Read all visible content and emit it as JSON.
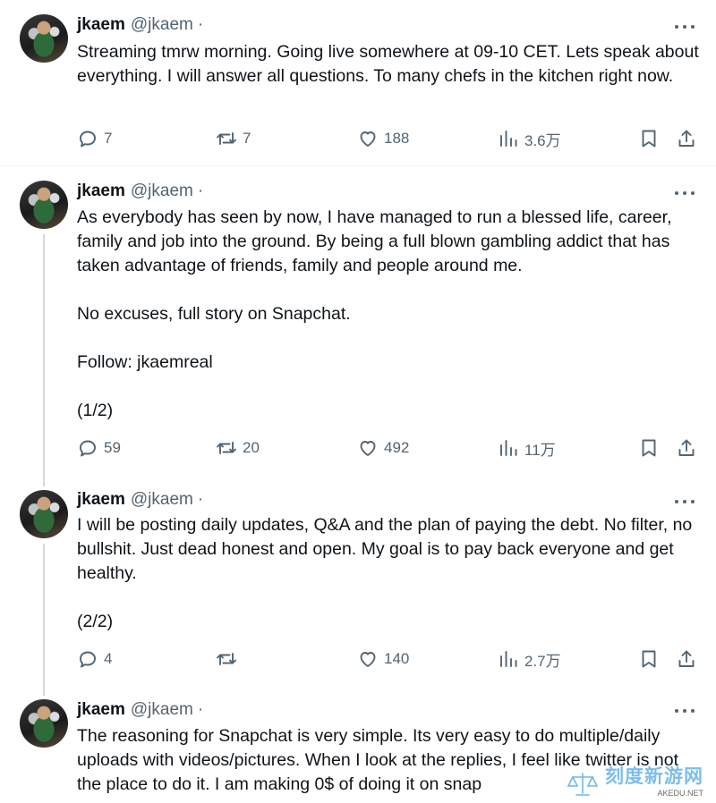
{
  "colors": {
    "text": "#0f1419",
    "secondary": "#536471",
    "divider": "#eff3f4",
    "thread_line": "#cfd9de"
  },
  "tweets": [
    {
      "name": "jkaem",
      "handle": "@jkaem",
      "separator": "·",
      "text": "Streaming tmrw morning. Going live somewhere at 09-10 CET. Lets speak about everything. I will answer all questions. To many chefs in the kitchen right now.",
      "replies": "7",
      "retweets": "7",
      "likes": "188",
      "views": "3.6万"
    },
    {
      "name": "jkaem",
      "handle": "@jkaem",
      "separator": "·",
      "text": "As everybody has seen by now, I have managed to run a blessed life, career, family and job into the ground. By being a full blown gambling addict that has taken advantage of friends, family and people around me.\n\nNo excuses, full story on Snapchat.\n\nFollow: jkaemreal\n\n(1/2)",
      "replies": "59",
      "retweets": "20",
      "likes": "492",
      "views": "11万"
    },
    {
      "name": "jkaem",
      "handle": "@jkaem",
      "separator": "·",
      "text": "I will be posting daily updates, Q&A and the plan of paying the debt. No filter, no bullshit. Just dead honest and open. My goal is to pay back everyone and get healthy.\n\n(2/2)",
      "replies": "4",
      "retweets": "",
      "likes": "140",
      "views": "2.7万"
    },
    {
      "name": "jkaem",
      "handle": "@jkaem",
      "separator": "·",
      "text": "The reasoning for Snapchat is very simple. Its very easy to do multiple/daily uploads with videos/pictures. When I look at the replies, I feel like twitter is not the place to do it. I am making 0$ of doing it on snap"
    }
  ],
  "icons": [
    "reply-icon",
    "retweet-icon",
    "like-icon",
    "views-icon",
    "bookmark-icon",
    "share-icon",
    "more-icon"
  ],
  "watermark": {
    "chinese": "刻度新游网",
    "english": "AKEDU.NET"
  }
}
